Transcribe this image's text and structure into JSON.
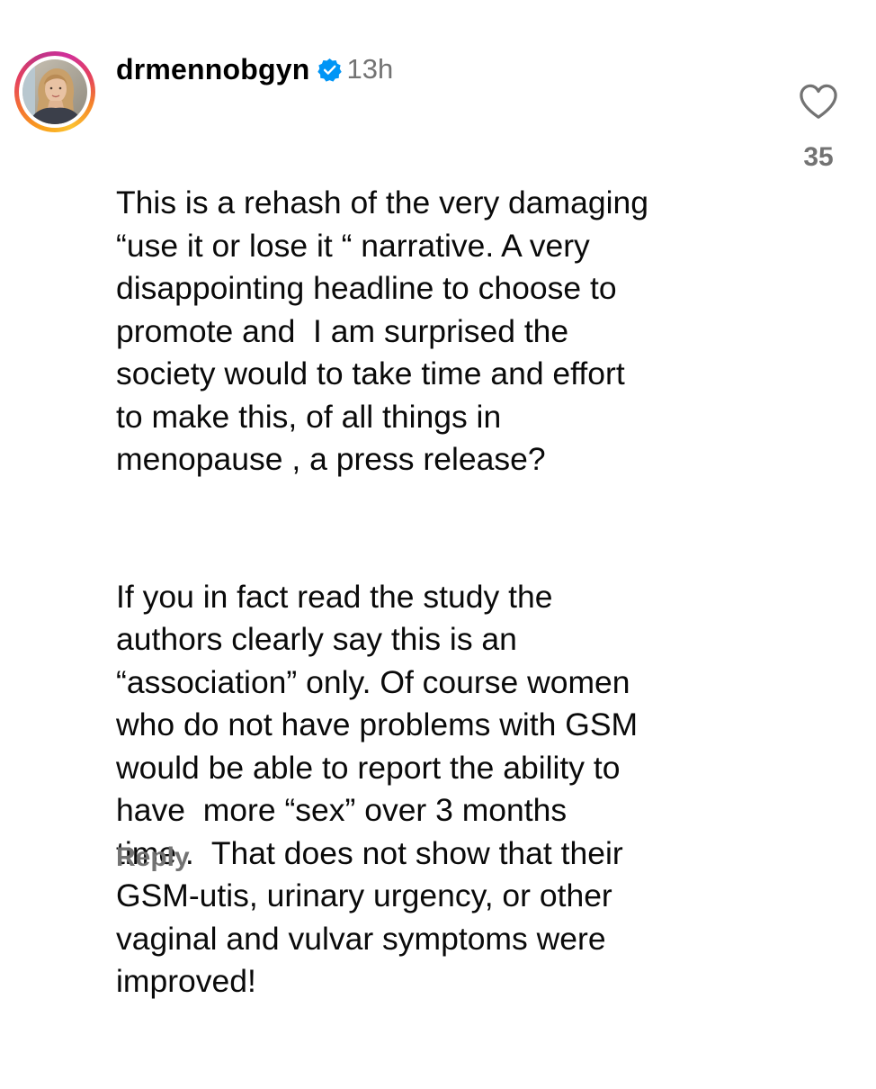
{
  "comment": {
    "username": "drmennobgyn",
    "verified_icon": "verified-badge-icon",
    "timestamp": "13h",
    "paragraphs": [
      "This is a rehash of the very damaging\n“use it or lose it “ narrative. A very\ndisappointing headline to choose to\npromote and  I am surprised the\nsociety would to take time and effort\nto make this, of all things in\nmenopause , a press release?",
      "If you in fact read the study the\nauthors clearly say this is an\n“association” only. Of course women\nwho do not have problems with GSM\nwould be able to report the ability to\nhave  more “sex” over 3 months\ntime .  That does not show that their\nGSM-utis, urinary urgency, or other\nvaginal and vulvar symptoms were\nimproved!"
    ],
    "like_icon": "heart-outline-icon",
    "like_count": "35",
    "reply_label": "Reply"
  },
  "colors": {
    "text": "#0a0a0a",
    "secondary_text": "#737373",
    "verified_blue": "#0095f6",
    "background": "#ffffff"
  }
}
